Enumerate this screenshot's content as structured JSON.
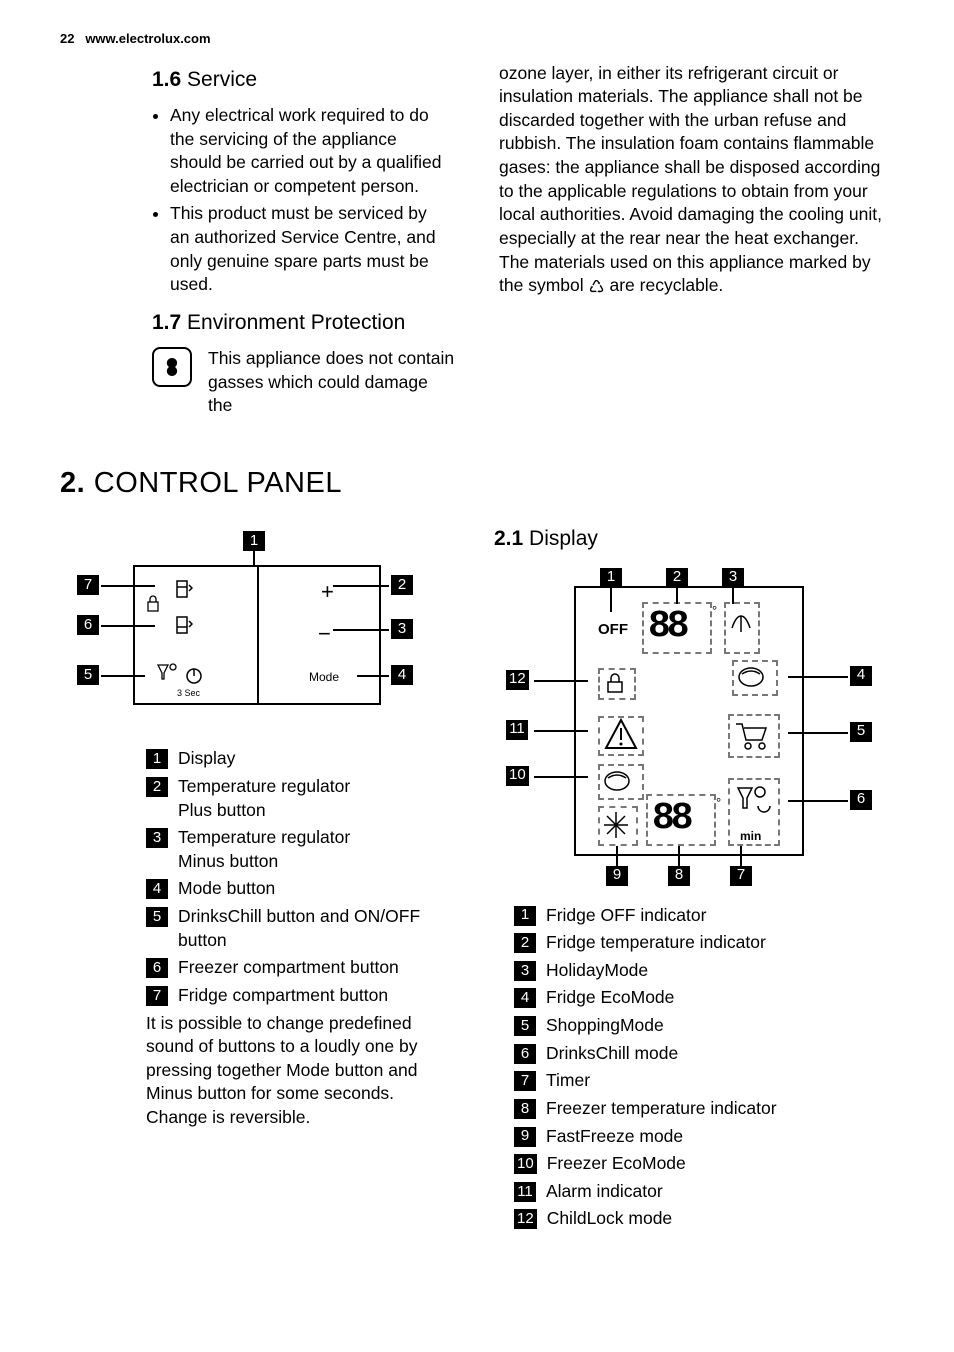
{
  "header": {
    "page": "22",
    "url": "www.electrolux.com"
  },
  "sec16": {
    "num": "1.6",
    "title": "Service",
    "b1": "Any electrical work required to do the servicing of the appliance should be carried out by a qualified electrician or competent person.",
    "b2": "This product must be serviced by an authorized Service Centre, and only genuine spare parts must be used."
  },
  "sec17": {
    "num": "1.7",
    "title": "Environment Protection",
    "leadA": "This appliance does not contain gasses which could damage the",
    "leadB_pre": "ozone layer, in either its refrigerant circuit or insulation materials. The appliance shall not be discarded together with the urban refuse and rubbish. The insulation foam contains flammable gases: the appliance shall be disposed according to the applicable regulations to obtain from your local authorities. Avoid damaging the cooling unit, especially at the rear near the heat exchanger. The materials used on this appliance marked by the symbol ",
    "leadB_post": " are recyclable."
  },
  "sec2": {
    "num": "2.",
    "title": "CONTROL PANEL"
  },
  "panel": {
    "labels": {
      "plus": "+",
      "minus": "−",
      "mode": "Mode",
      "off": "3 Sec"
    },
    "legend": {
      "1": "Display",
      "2": "Temperature regulator\nPlus button",
      "3": "Temperature regulator\nMinus button",
      "4": "Mode button",
      "5": "DrinksChill button and ON/OFF button",
      "6": "Freezer compartment button",
      "7": "Fridge compartment button"
    },
    "note": "It is possible to change predefined sound of buttons to a loudly one by pressing together Mode button and Minus button for some seconds. Change is reversible."
  },
  "sec21": {
    "num": "2.1",
    "title": "Display"
  },
  "display": {
    "off_label": "OFF",
    "min_label": "min",
    "legend": {
      "1": "Fridge OFF indicator",
      "2": "Fridge temperature indicator",
      "3": "HolidayMode",
      "4": "Fridge EcoMode",
      "5": "ShoppingMode",
      "6": "DrinksChill mode",
      "7": "Timer",
      "8": "Freezer temperature indicator",
      "9": "FastFreeze mode",
      "10": "Freezer EcoMode",
      "11": "Alarm indicator",
      "12": "ChildLock mode"
    }
  }
}
